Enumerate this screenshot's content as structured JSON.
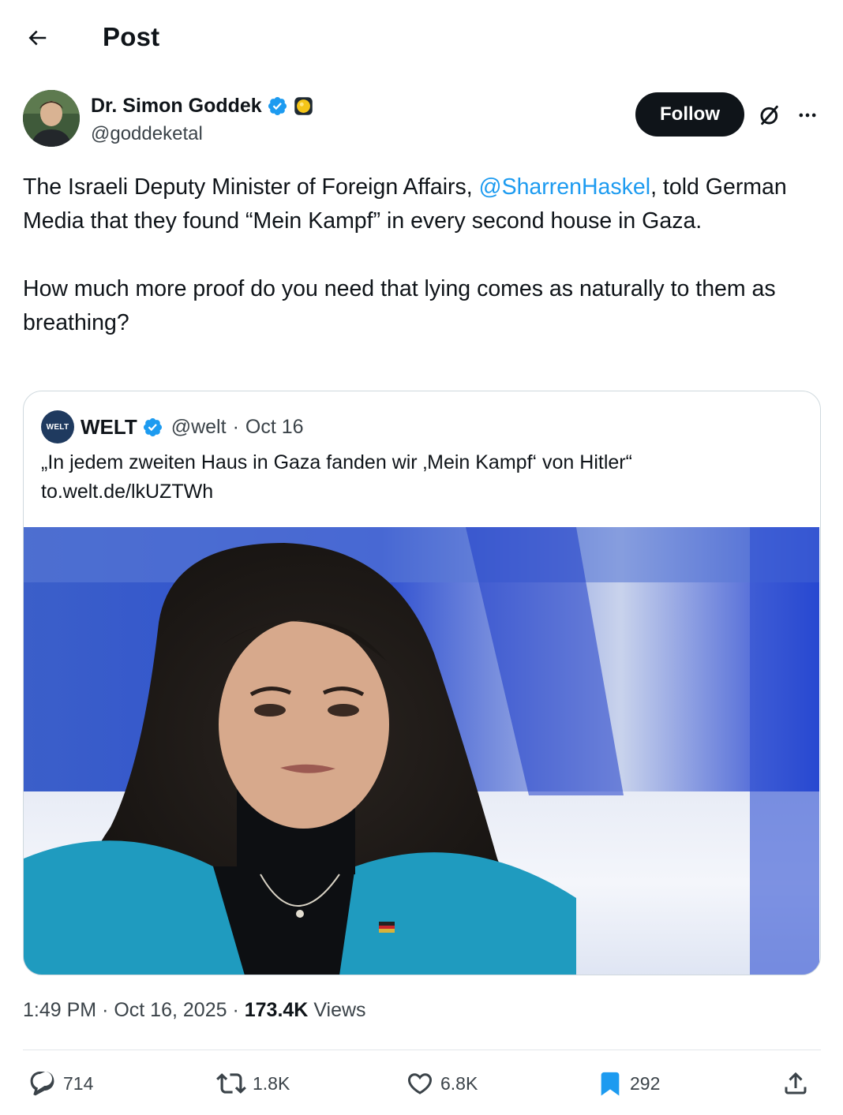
{
  "header": {
    "title": "Post",
    "back_icon": "arrow-left-icon"
  },
  "author": {
    "name": "Dr. Simon Goddek",
    "handle": "@goddeketal",
    "verified_color": "#1d9bf0",
    "follow_label": "Follow"
  },
  "tweet": {
    "line1_before": "The Israeli Deputy Minister of Foreign Affairs, ",
    "mention": "@SharrenHaskel",
    "line1_after": ", told German Media that they found “Mein Kampf” in every second house in Gaza.",
    "paragraph2": "How much more proof do you need that lying comes as naturally to them as breathing?"
  },
  "quote": {
    "avatar_text": "WELT",
    "name": "WELT",
    "handle": "@welt",
    "separator": "·",
    "date": "Oct 16",
    "text": "„In jedem zweiten Haus in Gaza fanden wir ‚Mein Kampf‘ von Hitler“",
    "link": "to.welt.de/lkUZTWh"
  },
  "meta": {
    "time": "1:49 PM",
    "sep1": "·",
    "date": "Oct 16, 2025",
    "sep2": "·",
    "views_count": "173.4K",
    "views_label": "Views"
  },
  "actions": {
    "replies": "714",
    "reposts": "1.8K",
    "likes": "6.8K",
    "bookmarks": "292",
    "bookmark_color": "#1d9bf0"
  }
}
